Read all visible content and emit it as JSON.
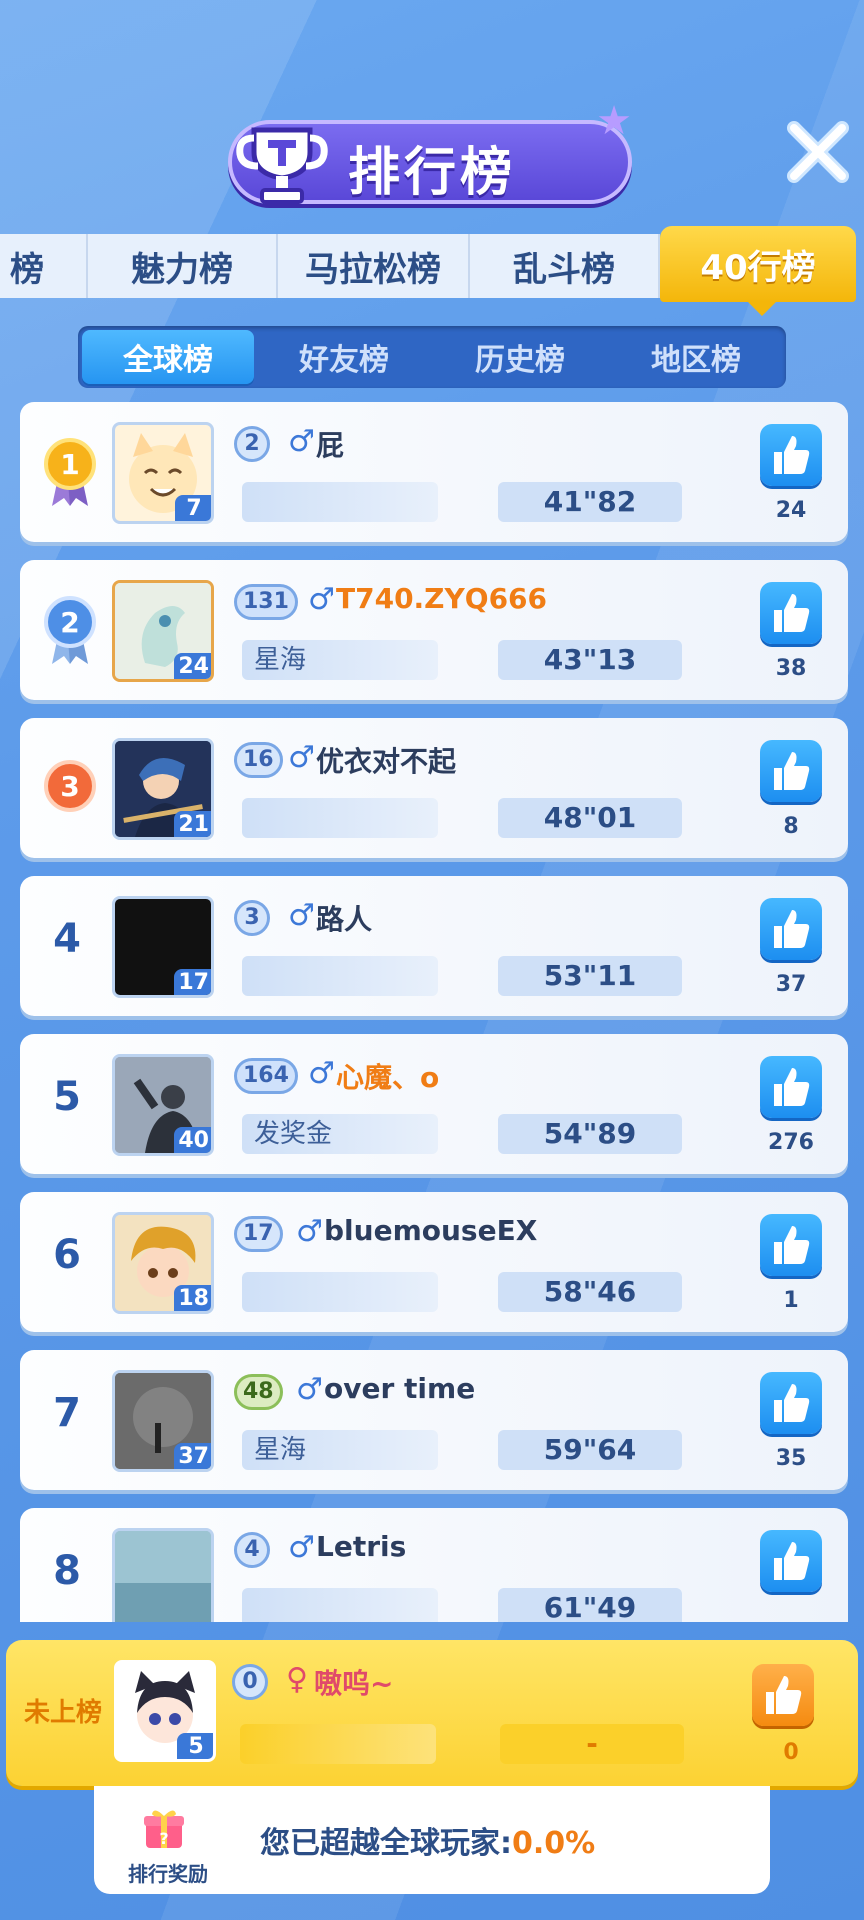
{
  "header": {
    "title": "排行榜"
  },
  "top_tabs": [
    "榜",
    "魅力榜",
    "马拉松榜",
    "乱斗榜",
    "40行榜"
  ],
  "sub_tabs": [
    "全球榜",
    "好友榜",
    "历史榜",
    "地区榜"
  ],
  "rows": [
    {
      "rank": "1",
      "badge": "2",
      "gender": "♂",
      "name": "屁",
      "team": "",
      "time": "41\"82",
      "likes": "24",
      "avatar_lv": "7",
      "name_color": "default"
    },
    {
      "rank": "2",
      "badge": "131",
      "gender": "♂",
      "name": "T740.ZYQ666",
      "team": "星海",
      "time": "43\"13",
      "likes": "38",
      "avatar_lv": "24",
      "name_color": "orange"
    },
    {
      "rank": "3",
      "badge": "16",
      "gender": "♂",
      "name": "优衣对不起",
      "team": "",
      "time": "48\"01",
      "likes": "8",
      "avatar_lv": "21",
      "name_color": "default"
    },
    {
      "rank": "4",
      "badge": "3",
      "gender": "♂",
      "name": "路人",
      "team": "",
      "time": "53\"11",
      "likes": "37",
      "avatar_lv": "17",
      "name_color": "default"
    },
    {
      "rank": "5",
      "badge": "164",
      "gender": "♂",
      "name": "心魔、o",
      "team": "发奖金",
      "time": "54\"89",
      "likes": "276",
      "avatar_lv": "40",
      "name_color": "orange"
    },
    {
      "rank": "6",
      "badge": "17",
      "gender": "♂",
      "name": "bluemouseEX",
      "team": "",
      "time": "58\"46",
      "likes": "1",
      "avatar_lv": "18",
      "name_color": "default"
    },
    {
      "rank": "7",
      "badge": "48",
      "gender": "♂",
      "name": "over time",
      "team": "星海",
      "time": "59\"64",
      "likes": "35",
      "avatar_lv": "37",
      "name_color": "default"
    },
    {
      "rank": "8",
      "badge": "4",
      "gender": "♂",
      "name": "Letris",
      "team": "",
      "time": "61\"49",
      "likes": "",
      "avatar_lv": "",
      "name_color": "default"
    }
  ],
  "self": {
    "label": "未上榜",
    "badge": "0",
    "gender": "♀",
    "name": "嗷呜~",
    "team": "",
    "time": "-",
    "likes": "0",
    "avatar_lv": "5"
  },
  "footer": {
    "reward_label": "排行奖励",
    "surpass_text": "您已超越全球玩家:",
    "surpass_pct": "0.0%"
  },
  "colors": {
    "accent": "#f4b60a",
    "primary": "#2c4e86",
    "orange": "#f07d15"
  }
}
